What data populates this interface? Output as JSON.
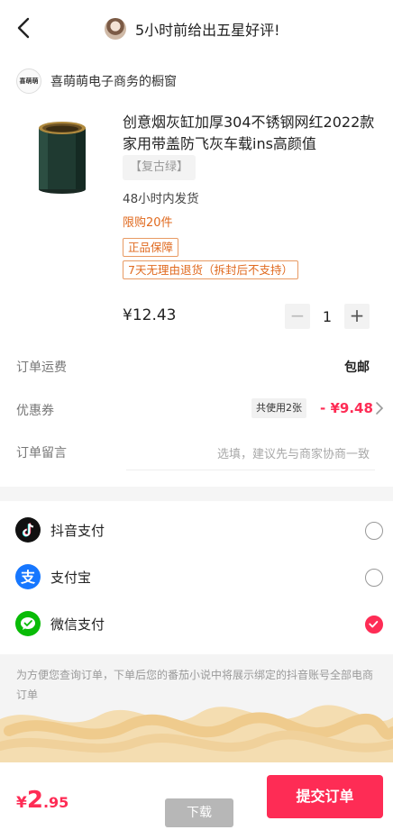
{
  "header": {
    "title": "5小时前给出五星好评!",
    "back_icon": "back-arrow-icon"
  },
  "shop": {
    "logo_text": "喜萌萌",
    "name": "喜萌萌电子商务的橱窗"
  },
  "product": {
    "name": "创意烟灰缸加厚304不锈钢网红2022款家用带盖防飞灰车载ins高颜值",
    "variant": "【复古绿】",
    "shipping_time": "48小时内发货",
    "limit": "限购20件",
    "tags": [
      "正品保障",
      "7天无理由退货（拆封后不支持）"
    ],
    "price": "¥12.43",
    "quantity": "1",
    "minus": "−",
    "plus": "+"
  },
  "order": {
    "shipping_label": "订单运费",
    "shipping_value": "包邮",
    "coupon_label": "优惠券",
    "coupon_badge": "共使用2张",
    "coupon_value": "- ¥9.48",
    "note_label": "订单留言",
    "note_placeholder": "选填，建议先与商家协商一致"
  },
  "payment": {
    "options": [
      {
        "label": "抖音支付",
        "icon": "douyin-pay-icon",
        "selected": false
      },
      {
        "label": "支付宝",
        "icon": "alipay-icon",
        "selected": false
      },
      {
        "label": "微信支付",
        "icon": "wechat-pay-icon",
        "selected": true
      }
    ]
  },
  "notice": {
    "text": "为方便您查询订单，下单后您的番茄小说中将展示绑定的抖音账号全部电商订单"
  },
  "footer": {
    "total_currency": "¥",
    "total_big": "2",
    "total_small": ".95",
    "download_label": "下载",
    "submit_label": "提交订单"
  },
  "colors": {
    "accent": "#fe2c55",
    "tag": "#e06a1f"
  }
}
